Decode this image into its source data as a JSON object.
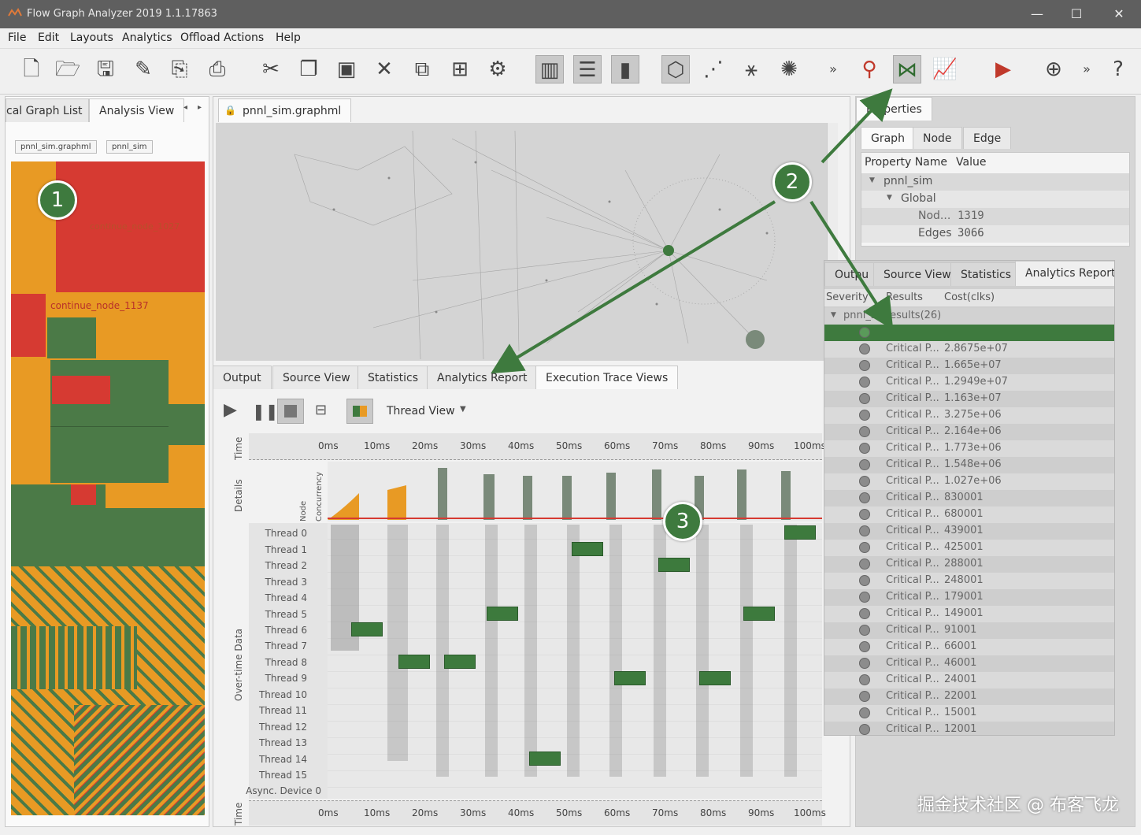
{
  "window": {
    "title": "Flow Graph Analyzer 2019 1.1.17863",
    "minimize": "—",
    "maximize": "☐",
    "close": "✕"
  },
  "menu": [
    "File",
    "Edit",
    "Layouts",
    "Analytics",
    "Offload Actions",
    "Help"
  ],
  "toolbar_overflow": "»",
  "left_panel": {
    "tabs": [
      "cal Graph List",
      "Analysis View"
    ],
    "breadcrumb": [
      "pnnl_sim.graphml",
      "pnnl_sim"
    ],
    "treemap_labels": [
      "continue_node_1137",
      "continue_node_1027"
    ]
  },
  "center": {
    "file_tab": "pnnl_sim.graphml",
    "bottom_tabs": [
      "Output",
      "Source View",
      "Statistics",
      "Analytics Report",
      "Execution Trace Views"
    ],
    "view_select": "Thread View",
    "time_ticks": [
      "0ms",
      "10ms",
      "20ms",
      "30ms",
      "40ms",
      "50ms",
      "60ms",
      "70ms",
      "80ms",
      "90ms",
      "100ms"
    ],
    "side_labels": {
      "time": "Time",
      "details": "Details",
      "node": "Node",
      "concurrency": "Concurrency",
      "overtime": "Over-time Data"
    },
    "threads": [
      "Thread 0",
      "Thread 1",
      "Thread 2",
      "Thread 3",
      "Thread 4",
      "Thread 5",
      "Thread 6",
      "Thread 7",
      "Thread 8",
      "Thread 9",
      "Thread 10",
      "Thread 11",
      "Thread 12",
      "Thread 13",
      "Thread 14",
      "Thread 15",
      "Async. Device 0"
    ]
  },
  "properties": {
    "tab": "Properties",
    "subtabs": [
      "Graph",
      "Node",
      "Edge"
    ],
    "headers": [
      "Property Name",
      "Value"
    ],
    "rows": [
      {
        "name": "pnnl_sim",
        "value": ""
      },
      {
        "name": "Global",
        "value": ""
      },
      {
        "name": "Nod...",
        "value": "1319"
      },
      {
        "name": "Edges",
        "value": "3066"
      }
    ]
  },
  "report": {
    "tabs": [
      "Outpu",
      "Source View",
      "Statistics",
      "Analytics Report"
    ],
    "headers": [
      "Severity",
      "Results",
      "Cost(clks)"
    ],
    "root": "pnnl_s...results(26)",
    "rows": [
      {
        "name": "Critical P...",
        "cost": "2.8675e+07"
      },
      {
        "name": "Critical P...",
        "cost": "1.665e+07"
      },
      {
        "name": "Critical P...",
        "cost": "1.2949e+07"
      },
      {
        "name": "Critical P...",
        "cost": "1.163e+07"
      },
      {
        "name": "Critical P...",
        "cost": "3.275e+06"
      },
      {
        "name": "Critical P...",
        "cost": "2.164e+06"
      },
      {
        "name": "Critical P...",
        "cost": "1.773e+06"
      },
      {
        "name": "Critical P...",
        "cost": "1.548e+06"
      },
      {
        "name": "Critical P...",
        "cost": "1.027e+06"
      },
      {
        "name": "Critical P...",
        "cost": "830001"
      },
      {
        "name": "Critical P...",
        "cost": "680001"
      },
      {
        "name": "Critical P...",
        "cost": "439001"
      },
      {
        "name": "Critical P...",
        "cost": "425001"
      },
      {
        "name": "Critical P...",
        "cost": "288001"
      },
      {
        "name": "Critical P...",
        "cost": "248001"
      },
      {
        "name": "Critical P...",
        "cost": "179001"
      },
      {
        "name": "Critical P...",
        "cost": "149001"
      },
      {
        "name": "Critical P...",
        "cost": "91001"
      },
      {
        "name": "Critical P...",
        "cost": "66001"
      },
      {
        "name": "Critical P...",
        "cost": "46001"
      },
      {
        "name": "Critical P...",
        "cost": "24001"
      },
      {
        "name": "Critical P...",
        "cost": "22001"
      },
      {
        "name": "Critical P...",
        "cost": "15001"
      },
      {
        "name": "Critical P...",
        "cost": "12001"
      }
    ]
  },
  "markers": [
    "1",
    "2",
    "3"
  ],
  "watermark": "掘金技术社区 @ 布客飞龙"
}
